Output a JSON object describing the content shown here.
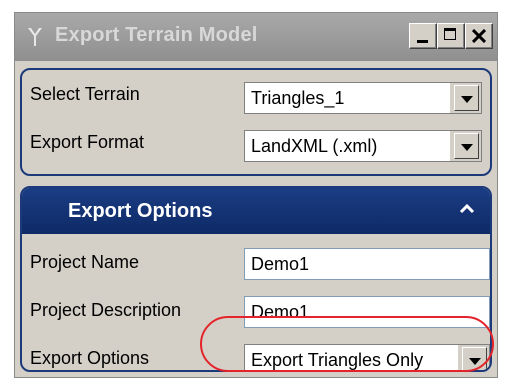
{
  "window": {
    "title": "Export Terrain Model"
  },
  "terrain": {
    "select_label": "Select Terrain",
    "select_value": "Triangles_1",
    "format_label": "Export Format",
    "format_value": "LandXML (.xml)"
  },
  "export_options": {
    "header": "Export Options",
    "project_name_label": "Project Name",
    "project_name_value": "Demo1",
    "project_desc_label": "Project Description",
    "project_desc_value": "Demo1",
    "options_label": "Export Options",
    "options_value": "Export Triangles Only"
  },
  "colors": {
    "header_blue": "#0e2a66",
    "annotation_red": "#e3242b"
  }
}
